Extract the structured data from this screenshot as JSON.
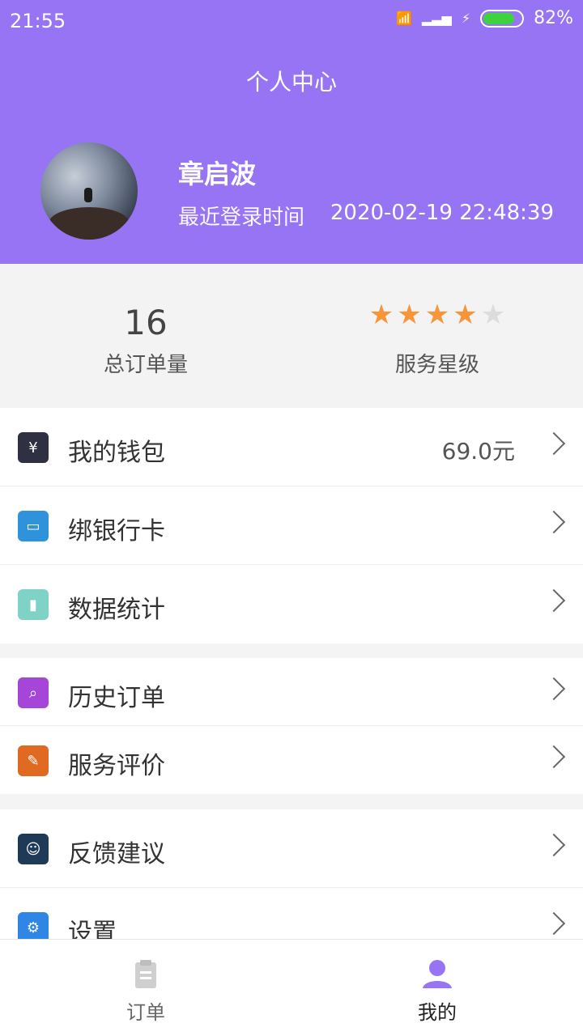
{
  "status_bar": {
    "time": "21:55",
    "battery": "82%"
  },
  "header": {
    "title": "个人中心",
    "user_name": "章启波",
    "login_label": "最近登录时间",
    "login_time": "2020-02-19 22:48:39"
  },
  "stats": {
    "orders": {
      "value": "16",
      "label": "总订单量"
    },
    "rating": {
      "label": "服务星级",
      "stars": 4,
      "max": 5
    }
  },
  "lists": {
    "group1": [
      {
        "icon": "wallet-icon",
        "label": "我的钱包",
        "value": "69.0元"
      },
      {
        "icon": "bank-card-icon",
        "label": "绑银行卡",
        "value": ""
      },
      {
        "icon": "chart-icon",
        "label": "数据统计",
        "value": ""
      }
    ],
    "group2": [
      {
        "icon": "history-order-icon",
        "label": "历史订单",
        "value": ""
      },
      {
        "icon": "review-icon",
        "label": "服务评价",
        "value": ""
      }
    ],
    "group3": [
      {
        "icon": "feedback-icon",
        "label": "反馈建议",
        "value": ""
      },
      {
        "icon": "settings-icon",
        "label": "设置",
        "value": ""
      }
    ]
  },
  "bottom_nav": {
    "items": [
      {
        "label": "订单",
        "icon": "clipboard-icon"
      },
      {
        "label": "我的",
        "icon": "user-icon"
      }
    ]
  },
  "colors": {
    "primary": "#9674f3",
    "star": "#f7953a",
    "star_off": "#dcdcdc"
  }
}
